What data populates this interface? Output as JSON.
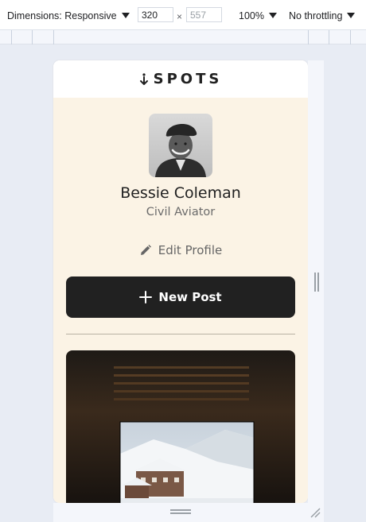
{
  "devtools": {
    "dimensions_label": "Dimensions: Responsive",
    "width_value": "320",
    "times": "×",
    "height_placeholder": "557",
    "zoom": "100%",
    "throttling": "No throttling"
  },
  "site": {
    "logo_text": "SPOTS",
    "profile": {
      "name": "Bessie Coleman",
      "role": "Civil Aviator",
      "edit_label": "Edit Profile"
    },
    "new_post_label": "New Post"
  },
  "colors": {
    "page_bg": "#fbf3e5",
    "button_bg": "#212121",
    "text_dark": "#212121",
    "text_muted": "#6b6b6b"
  },
  "icons": [
    "logo-mark-icon",
    "pencil-icon",
    "plus-icon",
    "chevron-down-icon"
  ]
}
